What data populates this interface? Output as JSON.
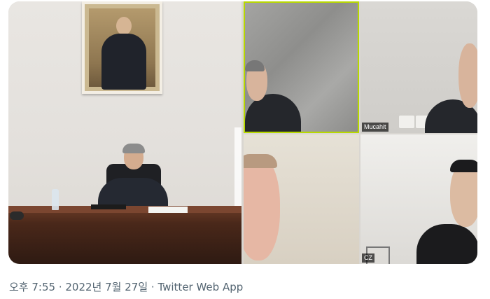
{
  "tweet": {
    "media": {
      "participants": [
        {
          "tile": "main",
          "name": ""
        },
        {
          "tile": "top-left",
          "name": ""
        },
        {
          "tile": "top-right",
          "name": "Mucahit"
        },
        {
          "tile": "bottom-left",
          "name": ""
        },
        {
          "tile": "bottom-right",
          "name": "CZ"
        }
      ],
      "active_speaker_color": "#b8d800"
    },
    "footer": {
      "time": "오후 7:55",
      "separator": " · ",
      "date": "2022년 7월 27일",
      "source": "Twitter Web App"
    }
  },
  "colors": {
    "meta_text": "#536471"
  }
}
